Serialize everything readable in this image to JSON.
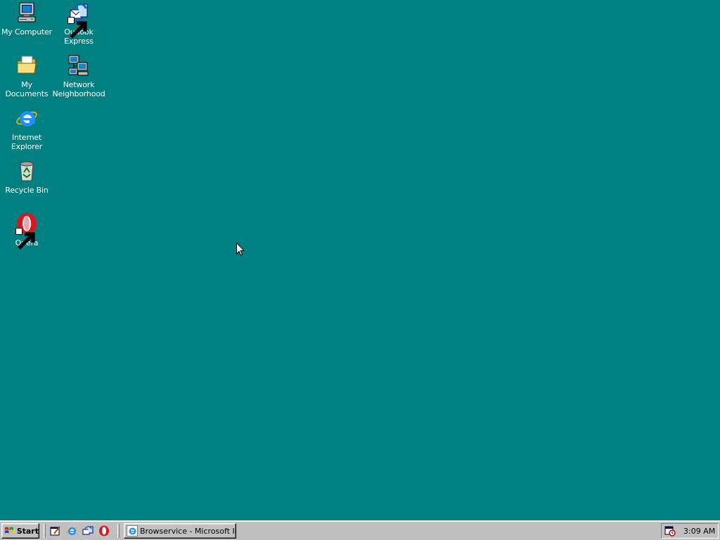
{
  "desktop": {
    "background_color": "#008080",
    "icons": [
      {
        "label": "My Computer",
        "icon": "my-computer-icon"
      },
      {
        "label": "Outlook Express",
        "icon": "outlook-express-icon",
        "shortcut": true
      },
      {
        "label": "My Documents",
        "icon": "my-documents-icon"
      },
      {
        "label": "Network Neighborhood",
        "icon": "network-neighborhood-icon"
      },
      {
        "label": "Internet Explorer",
        "icon": "internet-explorer-icon"
      },
      {
        "label": "Recycle Bin",
        "icon": "recycle-bin-icon"
      },
      {
        "label": "Opera",
        "icon": "opera-icon",
        "shortcut": true
      }
    ]
  },
  "taskbar": {
    "start_label": "Start",
    "quick_launch": [
      "show-desktop-icon",
      "internet-explorer-icon",
      "outlook-express-icon",
      "opera-icon"
    ],
    "tasks": [
      {
        "label": "Browservice - Microsoft Int...",
        "icon": "internet-explorer-icon"
      }
    ],
    "tray": {
      "icons": [
        "scheduler-icon"
      ],
      "clock": "3:09 AM"
    }
  }
}
